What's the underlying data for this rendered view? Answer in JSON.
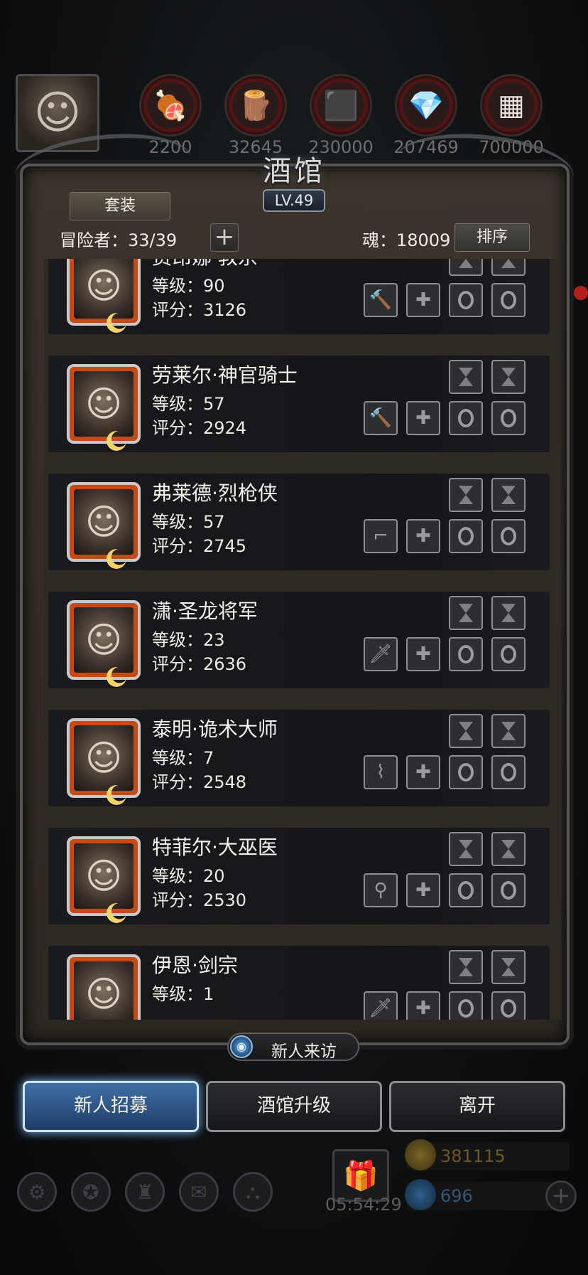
{
  "top_bar": {
    "avatar_icon": "bearded-sage-portrait",
    "resources": [
      {
        "icon": "meat-icon",
        "glyph": "🍖",
        "value": "2200"
      },
      {
        "icon": "wood-icon",
        "glyph": "🪵",
        "value": "32645"
      },
      {
        "icon": "iron-icon",
        "glyph": "⬛",
        "value": "230000"
      },
      {
        "icon": "crystal-icon",
        "glyph": "💎",
        "value": "207469"
      },
      {
        "icon": "steel-icon",
        "glyph": "▦",
        "value": "700000"
      }
    ]
  },
  "tavern": {
    "title": "酒馆",
    "level": "LV.49",
    "set_button": "套装",
    "adventurer_count": "冒险者：33/39",
    "plus": "+",
    "soul": "魂：18009",
    "sort_button": "排序"
  },
  "heroes": [
    {
      "name": "费昂娜·教宗",
      "level": "等级：90",
      "score": "评分：3126",
      "weapon": "hammer-icon",
      "weapon_glyph": "🔨",
      "portrait": "☺"
    },
    {
      "name": "劳莱尔·神官骑士",
      "level": "等级：57",
      "score": "评分：2924",
      "weapon": "hammer-icon",
      "weapon_glyph": "🔨",
      "portrait": "☺"
    },
    {
      "name": "弗莱德·烈枪侠",
      "level": "等级：57",
      "score": "评分：2745",
      "weapon": "gun-icon",
      "weapon_glyph": "⌐",
      "portrait": "☺"
    },
    {
      "name": "潇·圣龙将军",
      "level": "等级：23",
      "score": "评分：2636",
      "weapon": "sword-icon",
      "weapon_glyph": "🗡",
      "portrait": "☺"
    },
    {
      "name": "泰明·诡术大师",
      "level": "等级：7",
      "score": "评分：2548",
      "weapon": "dagger-icon",
      "weapon_glyph": "⌇",
      "portrait": "☺"
    },
    {
      "name": "特菲尔·大巫医",
      "level": "等级：20",
      "score": "评分：2530",
      "weapon": "staff-icon",
      "weapon_glyph": "⚲",
      "portrait": "☺"
    },
    {
      "name": "伊恩·剑宗",
      "level": "等级：1",
      "score": "",
      "weapon": "sword-icon",
      "weapon_glyph": "🗡",
      "portrait": "☺"
    }
  ],
  "bottom": {
    "newcomer_visit": "新人来访",
    "recruit": "新人招募",
    "upgrade": "酒馆升级",
    "leave": "离开",
    "timer": "05:54:29",
    "gold": "381115",
    "gems": "696",
    "plus": "+"
  },
  "colors": {
    "accent_blue": "#3f6fa6",
    "portrait_frame": "#c64a16",
    "panel_brown": "#3b342c"
  }
}
